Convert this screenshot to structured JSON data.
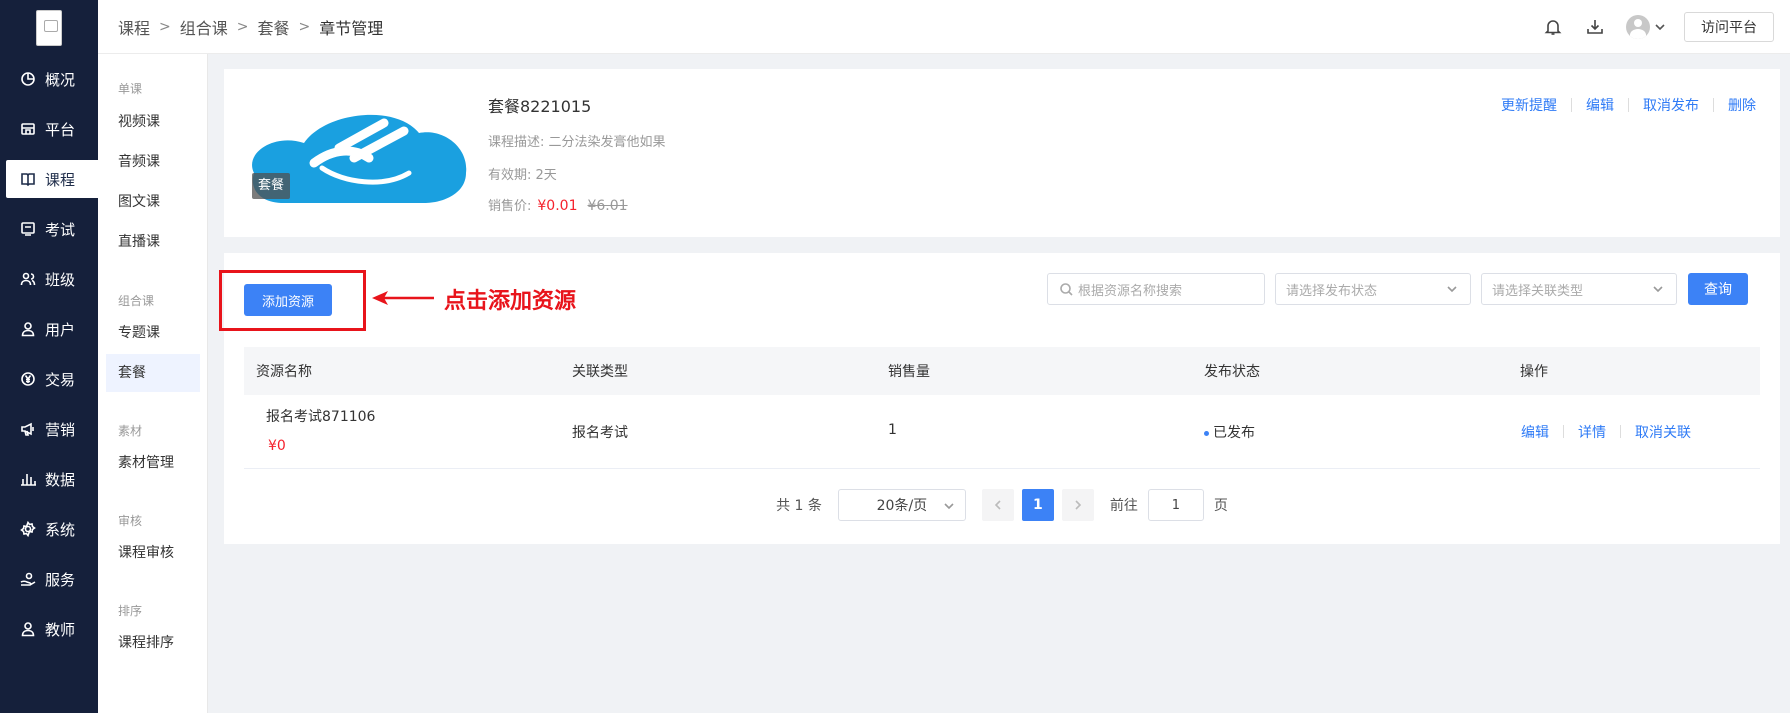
{
  "nav": {
    "items": [
      {
        "label": "概况",
        "icon": "pie-chart-icon"
      },
      {
        "label": "平台",
        "icon": "store-icon"
      },
      {
        "label": "课程",
        "icon": "book-icon"
      },
      {
        "label": "考试",
        "icon": "exam-icon"
      },
      {
        "label": "班级",
        "icon": "class-icon"
      },
      {
        "label": "用户",
        "icon": "user-icon"
      },
      {
        "label": "交易",
        "icon": "yen-icon"
      },
      {
        "label": "营销",
        "icon": "megaphone-icon"
      },
      {
        "label": "数据",
        "icon": "bar-chart-icon"
      },
      {
        "label": "系统",
        "icon": "gear-icon"
      },
      {
        "label": "服务",
        "icon": "service-icon"
      },
      {
        "label": "教师",
        "icon": "teacher-icon"
      }
    ],
    "active": "课程"
  },
  "submenu": {
    "groups": [
      {
        "title": "单课",
        "items": [
          "视频课",
          "音频课",
          "图文课",
          "直播课"
        ]
      },
      {
        "title": "组合课",
        "items": [
          "专题课",
          "套餐"
        ]
      },
      {
        "title": "素材",
        "items": [
          "素材管理"
        ]
      },
      {
        "title": "审核",
        "items": [
          "课程审核"
        ]
      },
      {
        "title": "排序",
        "items": [
          "课程排序"
        ]
      }
    ],
    "active": "套餐"
  },
  "breadcrumb": [
    "课程",
    "组合课",
    "套餐",
    "章节管理"
  ],
  "topbar": {
    "visit_label": "访问平台"
  },
  "course": {
    "tag": "套餐",
    "title": "套餐8221015",
    "desc_label": "课程描述:",
    "desc": "二分法染发膏他如果",
    "validity_label": "有效期:",
    "validity": "2天",
    "price_label": "销售价:",
    "price": "¥0.01",
    "old_price": "¥6.01",
    "actions": [
      "更新提醒",
      "编辑",
      "取消发布",
      "删除"
    ]
  },
  "toolbar": {
    "add_label": "添加资源",
    "annotation": "点击添加资源",
    "search_placeholder": "根据资源名称搜索",
    "status_placeholder": "请选择发布状态",
    "type_placeholder": "请选择关联类型",
    "query_label": "查询"
  },
  "table": {
    "headers": [
      "资源名称",
      "关联类型",
      "销售量",
      "发布状态",
      "操作"
    ],
    "rows": [
      {
        "name": "报名考试871106",
        "price": "¥0",
        "type": "报名考试",
        "sales": "1",
        "status": "已发布",
        "ops": [
          "编辑",
          "详情",
          "取消关联"
        ]
      }
    ]
  },
  "pager": {
    "total": "共 1 条",
    "page_size": "20条/页",
    "current": "1",
    "goto_label": "前往",
    "goto_value": "1",
    "page_suffix": "页"
  },
  "colors": {
    "primary": "#3c82f6",
    "nav_bg": "#15203b",
    "annotation_red": "#e8141b",
    "price_red": "#f5222d"
  }
}
